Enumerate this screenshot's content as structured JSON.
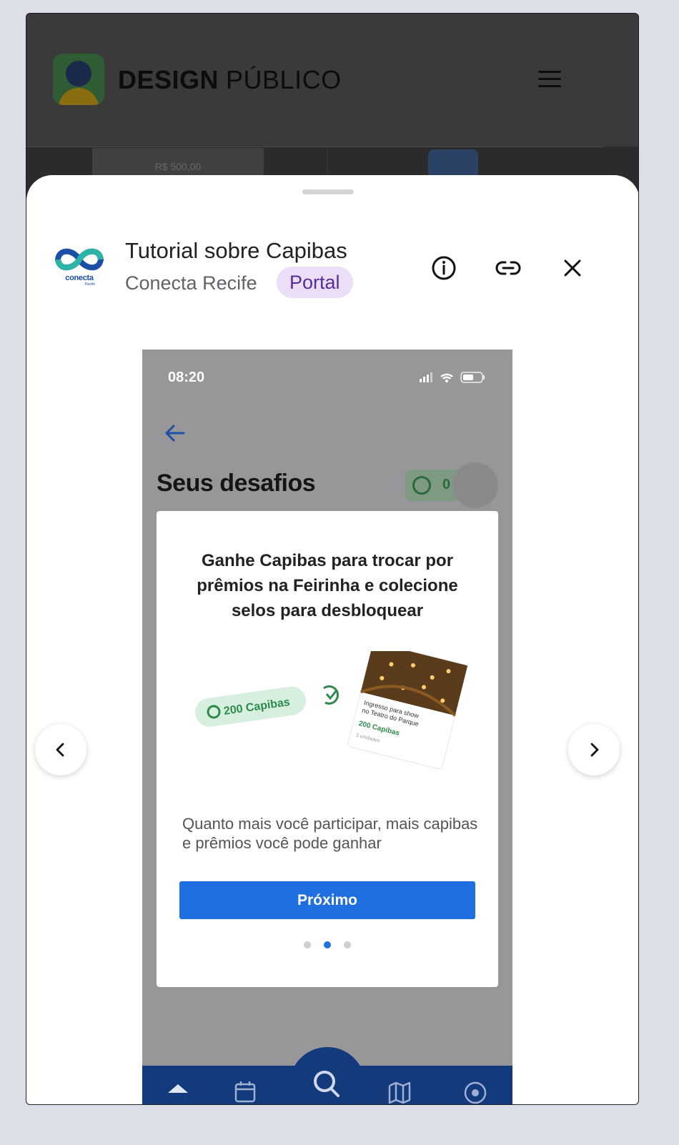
{
  "site": {
    "title_bold": "DESIGN",
    "title_light": "PÚBLICO",
    "menu_icon": "hamburger-icon",
    "bg_price": "R$ 500,00"
  },
  "app": {
    "name": "Tutorial sobre Capibas",
    "author": "Conecta Recife",
    "tag": "Portal",
    "logo_text": "conecta",
    "logo_sub": "Recife",
    "accent": "#5a2b9a",
    "tag_bg": "#eadff7"
  },
  "actions": {
    "info_icon": "info-icon",
    "link_icon": "link-icon",
    "close_icon": "close-icon"
  },
  "screenshot": {
    "time": "08:20",
    "heading": "Seus desafios",
    "coins": "0",
    "card_title": "Ganhe Capibas para trocar por prêmios na Feirinha e colecione selos para desbloquear",
    "pill_label": "200 Capibas",
    "ticket_title": "Ingresso para show no Teatro do Parque",
    "ticket_price": "200 Capibas",
    "ticket_units": "3 unidades",
    "description": "Quanto mais você participar, mais capibas e prêmios você pode ganhar",
    "button": "Próximo",
    "active_dot": 2,
    "dot_count": 3,
    "primary_color": "#1f6fe0",
    "tabbar_color": "#123a7d"
  },
  "nav": {
    "prev_icon": "chevron-left-icon",
    "next_icon": "chevron-right-icon"
  }
}
